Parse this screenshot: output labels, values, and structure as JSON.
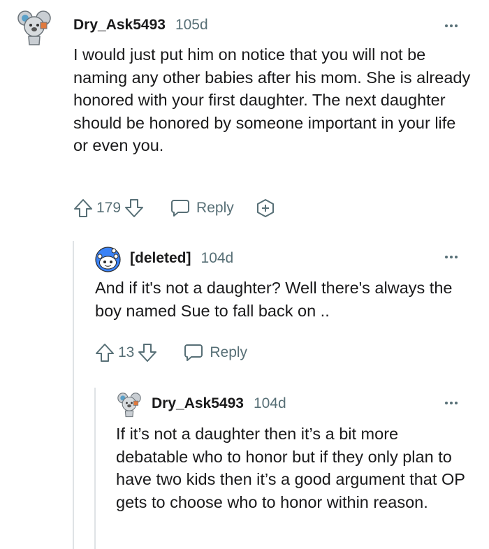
{
  "comments": [
    {
      "username": "Dry_Ask5493",
      "age": "105d",
      "body": "I would just put him on notice that you will not be naming any other babies after his mom. She is already honored with your first daughter. The next daughter should be honored by someone important in your life or even you.",
      "score": "179",
      "reply_label": "Reply",
      "avatar_icon": "koala-avatar-icon"
    },
    {
      "username": "[deleted]",
      "age": "104d",
      "body": "And if it's not a daughter? Well there's always the boy named Sue to fall back on ..",
      "score": "13",
      "reply_label": "Reply",
      "avatar_icon": "snoo-avatar-icon"
    },
    {
      "username": "Dry_Ask5493",
      "age": "104d",
      "body": "If it’s not a daughter then it’s a bit more debatable who to honor but if they only plan to have two kids then it’s a good argument that OP gets to choose who to honor within reason.",
      "avatar_icon": "koala-avatar-icon"
    }
  ],
  "colors": {
    "text": "#1a1a1b",
    "meta": "#576f76",
    "thread_line": "#dfe3e6",
    "snoo_blue": "#3b82f6"
  }
}
